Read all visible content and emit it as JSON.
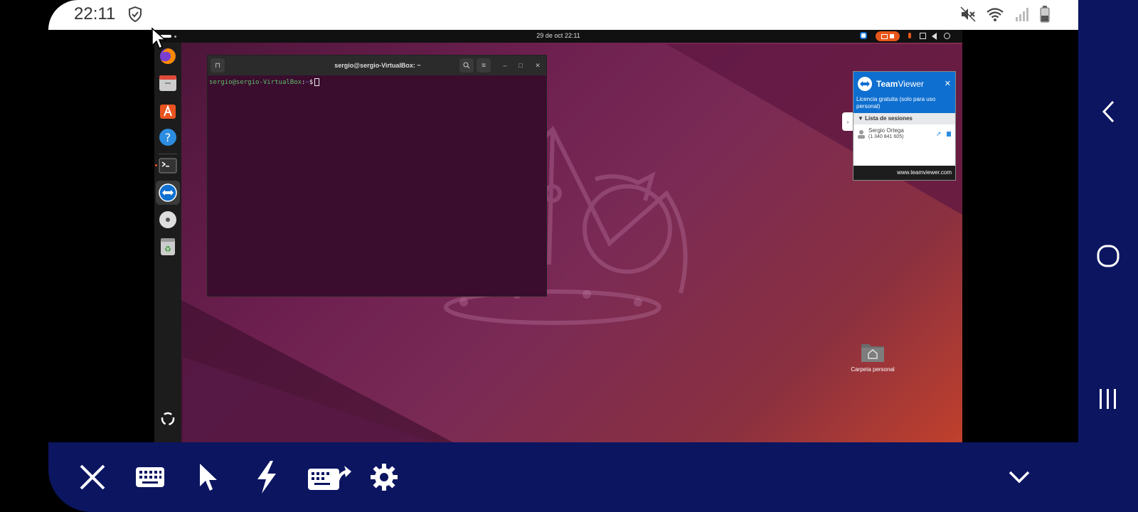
{
  "status_bar": {
    "time": "22:11"
  },
  "remote_desktop": {
    "topbar": {
      "clock": "29 de oct  22:11"
    },
    "terminal": {
      "title": "sergio@sergio-VirtualBox: ~",
      "prompt_user": "sergio@sergio-VirtualBox",
      "prompt_sep": ":",
      "prompt_path": "~",
      "prompt_symbol": "$"
    },
    "teamviewer": {
      "brand_bold": "Team",
      "brand_light": "Viewer",
      "license_text": "Licencia gratuita (solo para uso personal)",
      "close_glyph": "✕",
      "sessions_header": "Lista de sesiones",
      "session_name": "Sergio Ortega",
      "session_id": "(1 340 841 605)",
      "footer_link": "www.teamviewer.com"
    },
    "desktop_icons": [
      {
        "label": "Carpeta personal"
      }
    ],
    "dock": [
      "firefox-icon",
      "files-icon",
      "app-center-icon",
      "help-icon",
      "terminal-icon",
      "teamviewer-icon",
      "disc-icon",
      "trash-icon",
      "show-apps-icon"
    ]
  },
  "toolbar": {
    "buttons": [
      "close-icon",
      "keyboard-icon",
      "pointer-icon",
      "lightning-icon",
      "keyboard-special-icon",
      "settings-icon",
      "chevron-down-icon"
    ]
  },
  "colors": {
    "toolbar_bg": "#0c1560",
    "tv_blue": "#0e6fd0",
    "terminal_bg": "#3a0c2e"
  }
}
